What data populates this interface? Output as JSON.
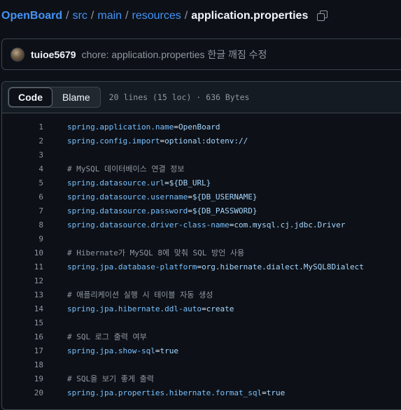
{
  "breadcrumb": {
    "repo": "OpenBoard",
    "segments": [
      "src",
      "main",
      "resources"
    ],
    "file": "application.properties",
    "separator": "/"
  },
  "commit": {
    "author": "tuioe5679",
    "message": "chore: application.properties 한글 깨짐 수정"
  },
  "file_header": {
    "tabs": [
      "Code",
      "Blame"
    ],
    "active_tab": "Code",
    "info": "20 lines (15 loc) · 636 Bytes"
  },
  "code_lines": [
    {
      "n": "1",
      "type": "kv",
      "key": "spring.application.name",
      "value": "OpenBoard"
    },
    {
      "n": "2",
      "type": "kv",
      "key": "spring.config.import",
      "value": "optional:dotenv://"
    },
    {
      "n": "3",
      "type": "blank"
    },
    {
      "n": "4",
      "type": "comment",
      "text": "# MySQL 데이터베이스 연결 정보"
    },
    {
      "n": "5",
      "type": "kv",
      "key": "spring.datasource.url",
      "value": "${DB_URL}"
    },
    {
      "n": "6",
      "type": "kv",
      "key": "spring.datasource.username",
      "value": "${DB_USERNAME}"
    },
    {
      "n": "7",
      "type": "kv",
      "key": "spring.datasource.password",
      "value": "${DB_PASSWORD}"
    },
    {
      "n": "8",
      "type": "kv",
      "key": "spring.datasource.driver-class-name",
      "value": "com.mysql.cj.jdbc.Driver"
    },
    {
      "n": "9",
      "type": "blank"
    },
    {
      "n": "10",
      "type": "comment",
      "text": "# Hibernate가 MySQL 8에 맞춰 SQL 방언 사용"
    },
    {
      "n": "11",
      "type": "kv",
      "key": "spring.jpa.database-platform",
      "value": "org.hibernate.dialect.MySQL8Dialect"
    },
    {
      "n": "12",
      "type": "blank"
    },
    {
      "n": "13",
      "type": "comment",
      "text": "# 애플리케이션 실행 시 테이블 자동 생성"
    },
    {
      "n": "14",
      "type": "kv",
      "key": "spring.jpa.hibernate.ddl-auto",
      "value": "create"
    },
    {
      "n": "15",
      "type": "blank"
    },
    {
      "n": "16",
      "type": "comment",
      "text": "# SQL 로그 출력 여부"
    },
    {
      "n": "17",
      "type": "kv",
      "key": "spring.jpa.show-sql",
      "value": "true"
    },
    {
      "n": "18",
      "type": "blank"
    },
    {
      "n": "19",
      "type": "comment",
      "text": "# SQL을 보기 좋게 출력"
    },
    {
      "n": "20",
      "type": "kv",
      "key": "spring.jpa.properties.hibernate.format_sql",
      "value": "true"
    }
  ],
  "icons": {
    "copy": "copy-path-icon",
    "avatar": "user-avatar"
  },
  "colors": {
    "background": "#0d1117",
    "link": "#4493f8",
    "key": "#79c0ff",
    "value": "#a5d6ff",
    "comment": "#9198a1"
  }
}
